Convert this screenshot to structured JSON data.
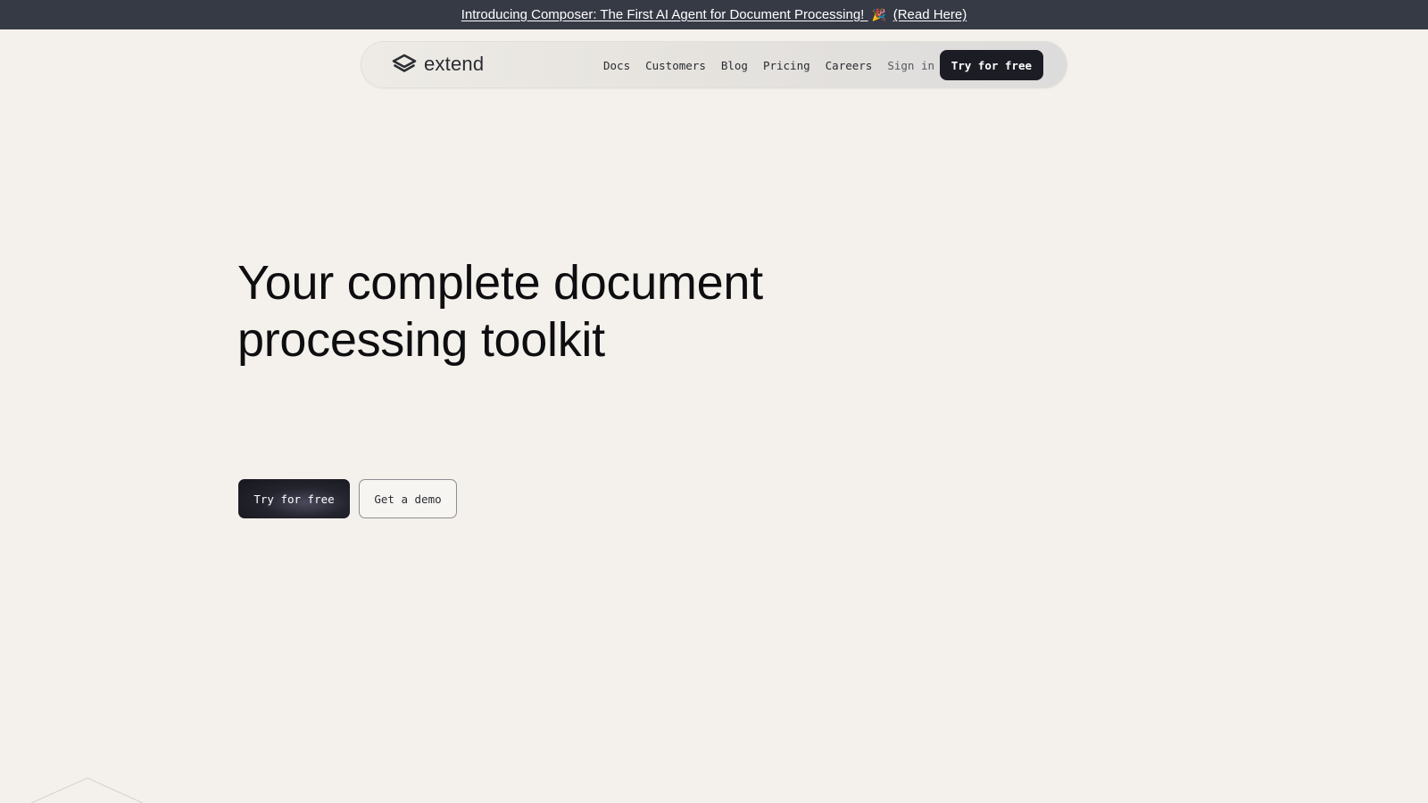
{
  "announcement": {
    "text": "Introducing Composer: The First AI Agent for Document Processing!",
    "emoji": "🎉",
    "link_text": "(Read Here)"
  },
  "nav": {
    "brand": "extend",
    "links": [
      "Docs",
      "Customers",
      "Blog",
      "Pricing",
      "Careers",
      "Sign in"
    ],
    "cta": "Try for free"
  },
  "hero": {
    "title_line1": "Your complete document",
    "title_line2": "processing toolkit",
    "primary_cta": "Try for free",
    "secondary_cta": "Get a demo"
  },
  "colors": {
    "background": "#f4f1ec",
    "announcement_bar": "#363a45",
    "primary_button": "#1c1d24"
  }
}
